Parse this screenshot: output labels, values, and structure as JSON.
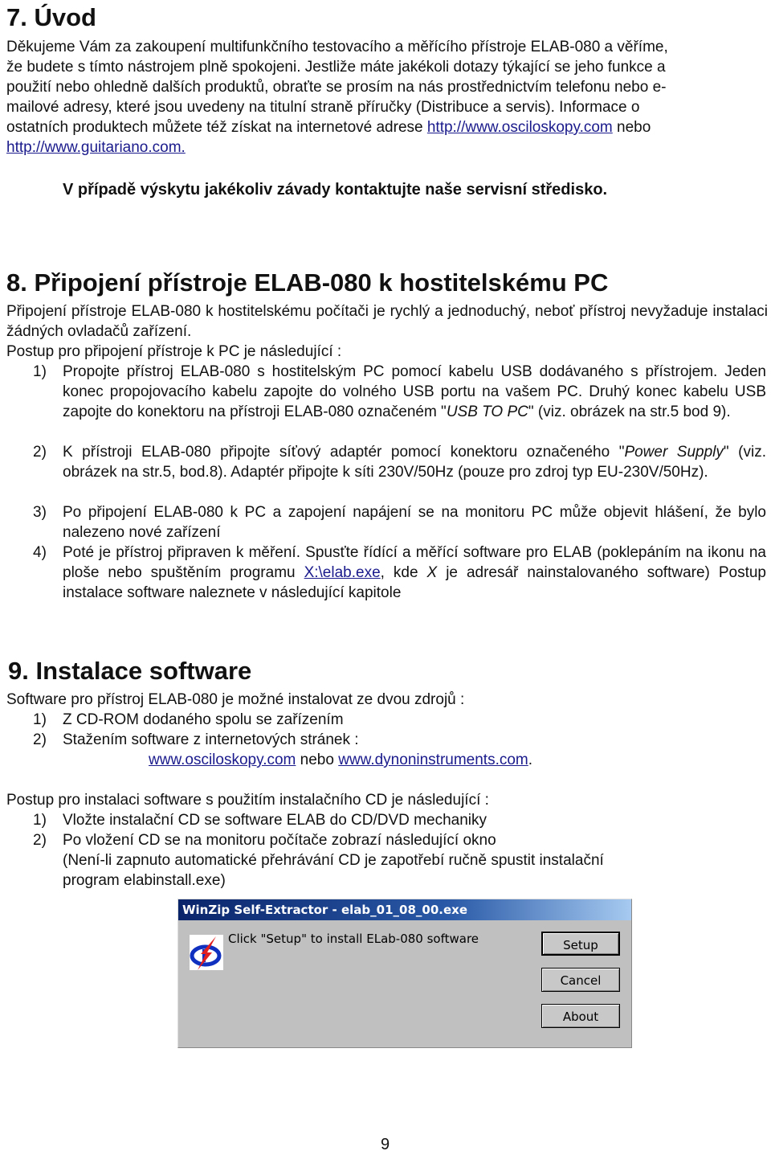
{
  "section7": {
    "title": "7. Úvod",
    "paragraph_lines": [
      "Děkujeme Vám za zakoupení multifunkčního testovacího a měřícího přístroje ELAB-080 a věříme,",
      "že  budete s tímto nástrojem plně spokojeni. Jestliže máte jakékoli dotazy týkající se jeho funkce a",
      "použití nebo ohledně dalších produktů, obraťte se prosím na nás  prostřednictvím telefonu nebo e-",
      "mailové adresy, které jsou uvedeny na titulní straně příručky (Distribuce a servis). Informace o"
    ],
    "line5_text": "ostatních produktech můžete též získat na internetové adrese",
    "link1": "http://www.osciloskopy.com",
    "line5_tail": "nebo",
    "link2": "http://www.guitariano.com.",
    "notice": "V případě výskytu jakékoliv závady kontaktujte naše servisní středisko."
  },
  "section8": {
    "title": "8. Připojení přístroje ELAB-080 k hostitelskému PC",
    "intro": "Připojení přístroje ELAB-080 k hostitelskému počítači je rychlý a jednoduchý, neboť přístroj nevyžaduje instalaci žádných ovladačů zařízení.",
    "procedure_heading": "Postup pro připojení přístroje k PC je následující :",
    "steps": [
      {
        "num": "1)",
        "text_before": "Propojte přístroj ELAB-080 s hostitelským PC pomocí kabelu USB dodávaného s přístrojem. Jeden konec propojovacího kabelu zapojte do volného USB portu na vašem PC. Druhý konec kabelu USB zapojte do konektoru na přístroji ELAB-080 označeném \"",
        "italic": "USB TO PC",
        "text_after": "\" (viz. obrázek na str.5 bod 9)."
      },
      {
        "num": "2)",
        "text_before": "K přístroji ELAB-080 připojte síťový adaptér pomocí konektoru označeného \"",
        "italic": "Power Supply",
        "text_after": "\" (viz. obrázek na str.5, bod.8). Adaptér připojte k síti 230V/50Hz (pouze pro zdroj typ EU-230V/50Hz)."
      },
      {
        "num": "3)",
        "text": "Po připojení ELAB-080 k PC a zapojení napájení se na monitoru PC může objevit hlášení, že bylo nalezeno nové zařízení"
      },
      {
        "num": "4)",
        "text_before": "Poté je přístroj připraven k měření. Spusťte řídící a měřící software pro ELAB (poklepáním na ikonu na ploše nebo spuštěním programu ",
        "link": "X:\\elab.exe",
        "text_mid": ", kde ",
        "italic": "X",
        "text_after": " je adresář nainstalovaného software) Postup instalace software naleznete v následující kapitole"
      }
    ]
  },
  "section9": {
    "title": "9. Instalace software",
    "intro": "Software pro přístroj ELAB-080 je možné instalovat ze dvou zdrojů :",
    "sources": [
      {
        "num": "1)",
        "text": "Z CD-ROM dodaného spolu se zařízením"
      },
      {
        "num": "2)",
        "text": "Stažením software z internetových stránek :"
      }
    ],
    "site1": "www.osciloskopy.com",
    "sites_sep": "nebo",
    "site2": "www.dynoninstruments.com",
    "sites_end": ".",
    "procedure_heading": "Postup pro instalaci software s použitím instalačního CD je následující :",
    "steps": [
      {
        "num": "1)",
        "text": "Vložte instalační CD se software ELAB do CD/DVD mechaniky"
      },
      {
        "num": "2)",
        "text": "Po vložení CD se na monitoru počítače zobrazí následující okno"
      }
    ],
    "note_line1": "(Není-li zapnuto automatické přehrávání CD je zapotřebí ručně spustit instalační",
    "note_line2": "program elabinstall.exe)"
  },
  "dialog": {
    "title": "WinZip Self-Extractor - elab_01_08_00.exe",
    "icon": "elab-logo-icon",
    "message": "Click \"Setup\" to install ELab-080 software",
    "buttons": {
      "setup": "Setup",
      "cancel": "Cancel",
      "about": "About"
    },
    "colors": {
      "title_start": "#0a246a",
      "title_end": "#a6caf0",
      "face": "#c0c0c0"
    }
  },
  "page_number": "9"
}
